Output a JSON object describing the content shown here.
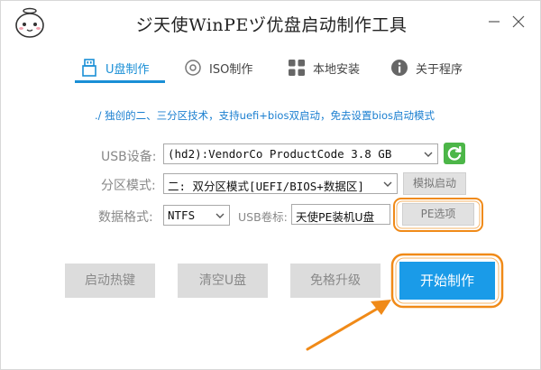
{
  "window": {
    "title": "ジ天使WinPEヅ优盘启动制作工具"
  },
  "tabs": [
    {
      "label": "U盘制作",
      "active": true,
      "icon": "usb-icon"
    },
    {
      "label": "ISO制作",
      "active": false,
      "icon": "disc-icon"
    },
    {
      "label": "本地安装",
      "active": false,
      "icon": "grid-icon"
    },
    {
      "label": "关于程序",
      "active": false,
      "icon": "info-icon"
    }
  ],
  "feature_text": "./ 独创的二、三分区技术，支持uefi+bios双启动，免去设置bios启动模式",
  "form": {
    "usb_device_label": "USB设备:",
    "usb_device_value": "(hd2):VendorCo ProductCode 3.8 GB",
    "partition_mode_label": "分区模式:",
    "partition_mode_value": "二: 双分区模式[UEFI/BIOS+数据区]",
    "simulate_boot_label": "模拟启动",
    "data_format_label": "数据格式:",
    "data_format_value": "NTFS",
    "usb_volume_label": "USB卷标:",
    "usb_volume_value": "天使PE装机U盘",
    "pe_options_label": "PE选项"
  },
  "actions": {
    "hotkey_label": "启动热键",
    "clear_label": "清空U盘",
    "upgrade_label": "免格升级",
    "start_label": "开始制作"
  },
  "colors": {
    "accent": "#1a8fd6",
    "start_button": "#1a9be8",
    "refresh_button": "#4cb648",
    "annotation": "#f08a18"
  }
}
